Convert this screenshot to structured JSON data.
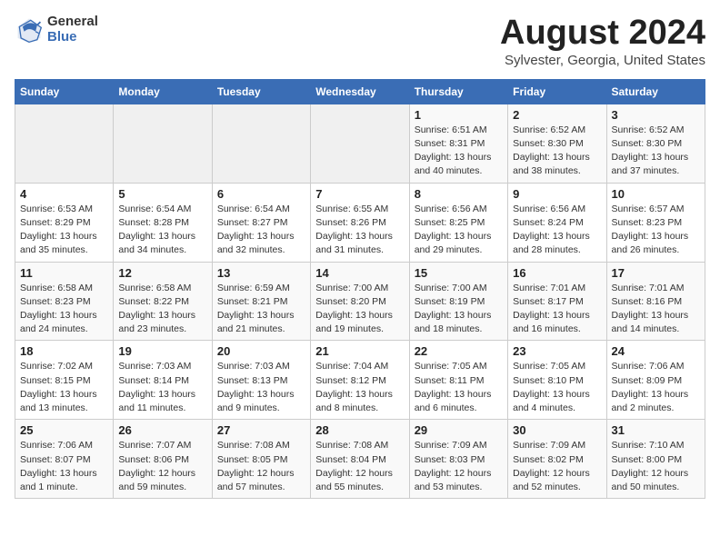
{
  "logo": {
    "general": "General",
    "blue": "Blue"
  },
  "title": "August 2024",
  "subtitle": "Sylvester, Georgia, United States",
  "days_of_week": [
    "Sunday",
    "Monday",
    "Tuesday",
    "Wednesday",
    "Thursday",
    "Friday",
    "Saturday"
  ],
  "weeks": [
    [
      {
        "day": "",
        "sunrise": "",
        "sunset": "",
        "daylight": "",
        "empty": true
      },
      {
        "day": "",
        "sunrise": "",
        "sunset": "",
        "daylight": "",
        "empty": true
      },
      {
        "day": "",
        "sunrise": "",
        "sunset": "",
        "daylight": "",
        "empty": true
      },
      {
        "day": "",
        "sunrise": "",
        "sunset": "",
        "daylight": "",
        "empty": true
      },
      {
        "day": "1",
        "sunrise": "Sunrise: 6:51 AM",
        "sunset": "Sunset: 8:31 PM",
        "daylight": "Daylight: 13 hours and 40 minutes."
      },
      {
        "day": "2",
        "sunrise": "Sunrise: 6:52 AM",
        "sunset": "Sunset: 8:30 PM",
        "daylight": "Daylight: 13 hours and 38 minutes."
      },
      {
        "day": "3",
        "sunrise": "Sunrise: 6:52 AM",
        "sunset": "Sunset: 8:30 PM",
        "daylight": "Daylight: 13 hours and 37 minutes."
      }
    ],
    [
      {
        "day": "4",
        "sunrise": "Sunrise: 6:53 AM",
        "sunset": "Sunset: 8:29 PM",
        "daylight": "Daylight: 13 hours and 35 minutes."
      },
      {
        "day": "5",
        "sunrise": "Sunrise: 6:54 AM",
        "sunset": "Sunset: 8:28 PM",
        "daylight": "Daylight: 13 hours and 34 minutes."
      },
      {
        "day": "6",
        "sunrise": "Sunrise: 6:54 AM",
        "sunset": "Sunset: 8:27 PM",
        "daylight": "Daylight: 13 hours and 32 minutes."
      },
      {
        "day": "7",
        "sunrise": "Sunrise: 6:55 AM",
        "sunset": "Sunset: 8:26 PM",
        "daylight": "Daylight: 13 hours and 31 minutes."
      },
      {
        "day": "8",
        "sunrise": "Sunrise: 6:56 AM",
        "sunset": "Sunset: 8:25 PM",
        "daylight": "Daylight: 13 hours and 29 minutes."
      },
      {
        "day": "9",
        "sunrise": "Sunrise: 6:56 AM",
        "sunset": "Sunset: 8:24 PM",
        "daylight": "Daylight: 13 hours and 28 minutes."
      },
      {
        "day": "10",
        "sunrise": "Sunrise: 6:57 AM",
        "sunset": "Sunset: 8:23 PM",
        "daylight": "Daylight: 13 hours and 26 minutes."
      }
    ],
    [
      {
        "day": "11",
        "sunrise": "Sunrise: 6:58 AM",
        "sunset": "Sunset: 8:23 PM",
        "daylight": "Daylight: 13 hours and 24 minutes."
      },
      {
        "day": "12",
        "sunrise": "Sunrise: 6:58 AM",
        "sunset": "Sunset: 8:22 PM",
        "daylight": "Daylight: 13 hours and 23 minutes."
      },
      {
        "day": "13",
        "sunrise": "Sunrise: 6:59 AM",
        "sunset": "Sunset: 8:21 PM",
        "daylight": "Daylight: 13 hours and 21 minutes."
      },
      {
        "day": "14",
        "sunrise": "Sunrise: 7:00 AM",
        "sunset": "Sunset: 8:20 PM",
        "daylight": "Daylight: 13 hours and 19 minutes."
      },
      {
        "day": "15",
        "sunrise": "Sunrise: 7:00 AM",
        "sunset": "Sunset: 8:19 PM",
        "daylight": "Daylight: 13 hours and 18 minutes."
      },
      {
        "day": "16",
        "sunrise": "Sunrise: 7:01 AM",
        "sunset": "Sunset: 8:17 PM",
        "daylight": "Daylight: 13 hours and 16 minutes."
      },
      {
        "day": "17",
        "sunrise": "Sunrise: 7:01 AM",
        "sunset": "Sunset: 8:16 PM",
        "daylight": "Daylight: 13 hours and 14 minutes."
      }
    ],
    [
      {
        "day": "18",
        "sunrise": "Sunrise: 7:02 AM",
        "sunset": "Sunset: 8:15 PM",
        "daylight": "Daylight: 13 hours and 13 minutes."
      },
      {
        "day": "19",
        "sunrise": "Sunrise: 7:03 AM",
        "sunset": "Sunset: 8:14 PM",
        "daylight": "Daylight: 13 hours and 11 minutes."
      },
      {
        "day": "20",
        "sunrise": "Sunrise: 7:03 AM",
        "sunset": "Sunset: 8:13 PM",
        "daylight": "Daylight: 13 hours and 9 minutes."
      },
      {
        "day": "21",
        "sunrise": "Sunrise: 7:04 AM",
        "sunset": "Sunset: 8:12 PM",
        "daylight": "Daylight: 13 hours and 8 minutes."
      },
      {
        "day": "22",
        "sunrise": "Sunrise: 7:05 AM",
        "sunset": "Sunset: 8:11 PM",
        "daylight": "Daylight: 13 hours and 6 minutes."
      },
      {
        "day": "23",
        "sunrise": "Sunrise: 7:05 AM",
        "sunset": "Sunset: 8:10 PM",
        "daylight": "Daylight: 13 hours and 4 minutes."
      },
      {
        "day": "24",
        "sunrise": "Sunrise: 7:06 AM",
        "sunset": "Sunset: 8:09 PM",
        "daylight": "Daylight: 13 hours and 2 minutes."
      }
    ],
    [
      {
        "day": "25",
        "sunrise": "Sunrise: 7:06 AM",
        "sunset": "Sunset: 8:07 PM",
        "daylight": "Daylight: 13 hours and 1 minute."
      },
      {
        "day": "26",
        "sunrise": "Sunrise: 7:07 AM",
        "sunset": "Sunset: 8:06 PM",
        "daylight": "Daylight: 12 hours and 59 minutes."
      },
      {
        "day": "27",
        "sunrise": "Sunrise: 7:08 AM",
        "sunset": "Sunset: 8:05 PM",
        "daylight": "Daylight: 12 hours and 57 minutes."
      },
      {
        "day": "28",
        "sunrise": "Sunrise: 7:08 AM",
        "sunset": "Sunset: 8:04 PM",
        "daylight": "Daylight: 12 hours and 55 minutes."
      },
      {
        "day": "29",
        "sunrise": "Sunrise: 7:09 AM",
        "sunset": "Sunset: 8:03 PM",
        "daylight": "Daylight: 12 hours and 53 minutes."
      },
      {
        "day": "30",
        "sunrise": "Sunrise: 7:09 AM",
        "sunset": "Sunset: 8:02 PM",
        "daylight": "Daylight: 12 hours and 52 minutes."
      },
      {
        "day": "31",
        "sunrise": "Sunrise: 7:10 AM",
        "sunset": "Sunset: 8:00 PM",
        "daylight": "Daylight: 12 hours and 50 minutes."
      }
    ]
  ]
}
